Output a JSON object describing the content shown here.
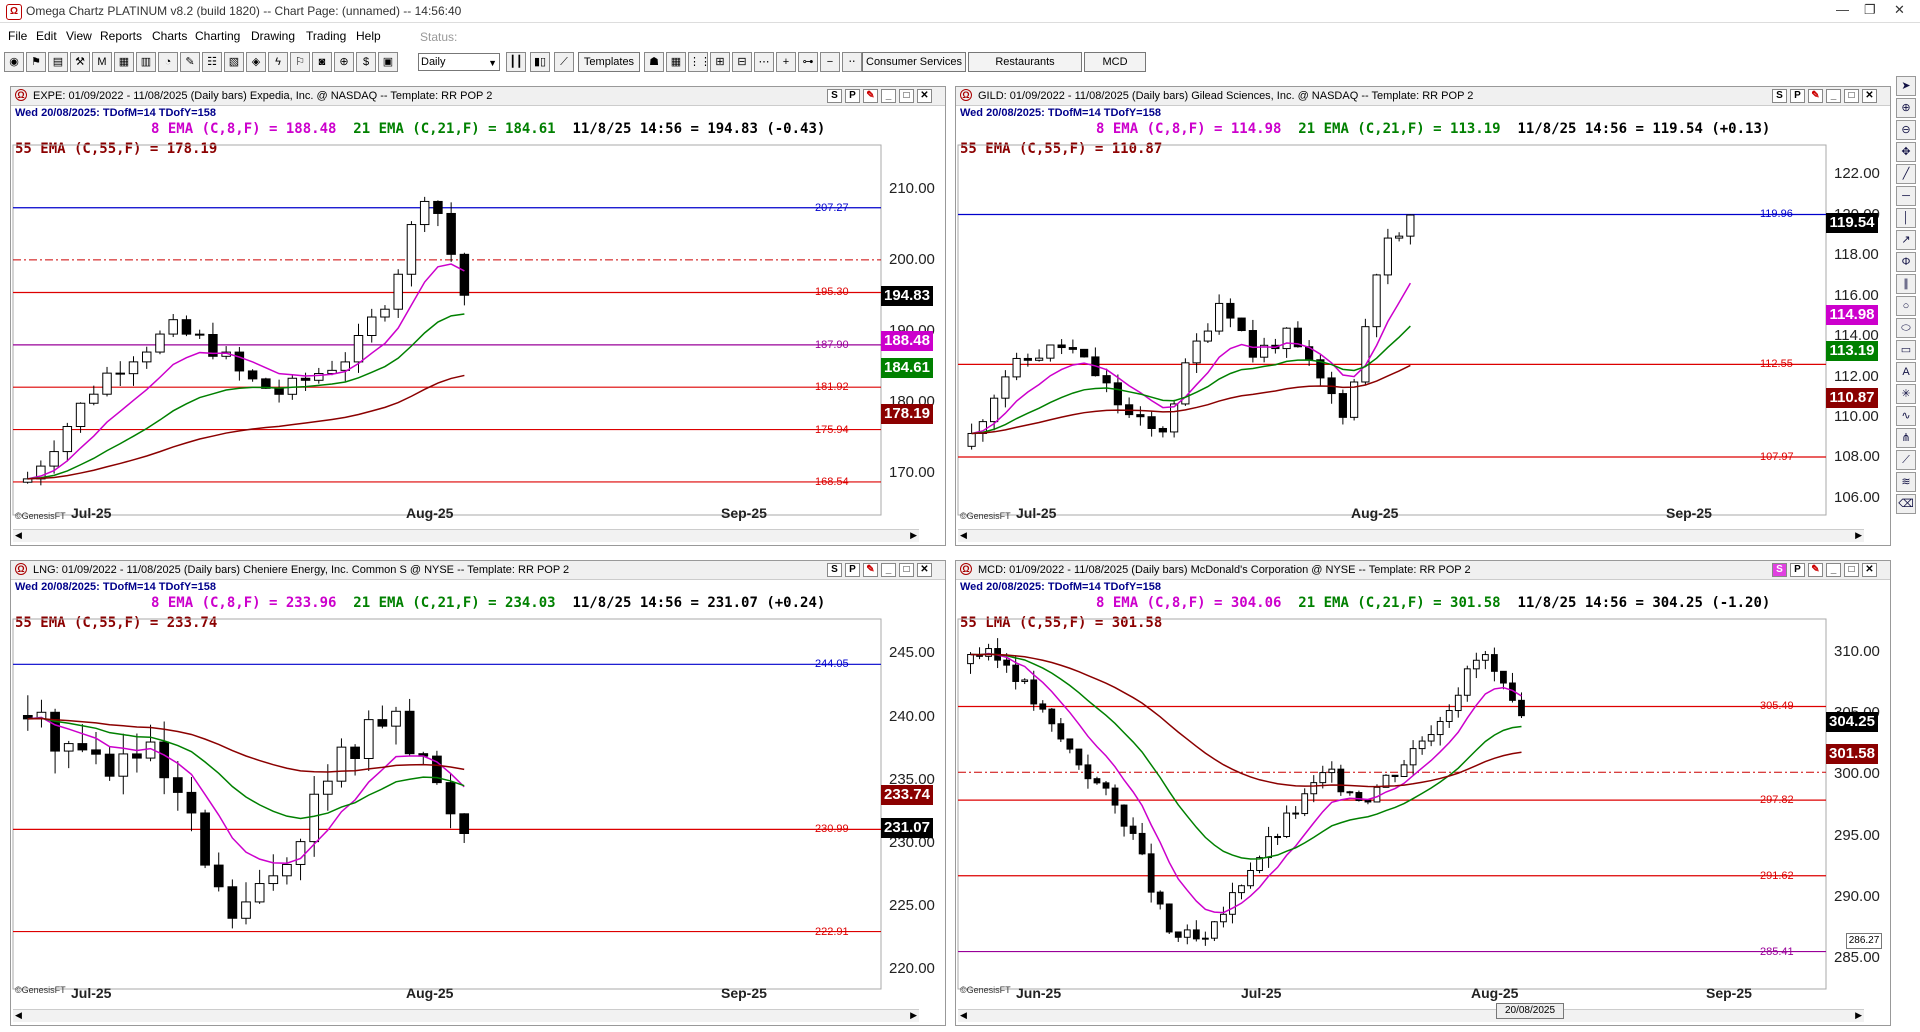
{
  "window": {
    "title": "Omega Chartz PLATINUM v8.2 (build 1820)  --  Chart Page: (unnamed) -- 14:56:40",
    "icon": "app-logo-icon",
    "controls": [
      "minimize-icon",
      "restore-icon",
      "close-icon"
    ]
  },
  "menu": {
    "items": [
      "File",
      "Edit",
      "View",
      "Reports",
      "Charts",
      "Charting",
      "Drawing",
      "Trading",
      "Help"
    ],
    "status_label": "Status:"
  },
  "toolbar": {
    "period_select": "Daily",
    "templates_label": "Templates",
    "tabs": [
      "Consumer Services",
      "Restaurants",
      "MCD"
    ]
  },
  "panels": [
    {
      "header": "EXPE: 01/09/2022 - 11/08/2025  (Daily bars)  Expedia, Inc. @ NASDAQ  --  Template: RR POP 2",
      "date_line": "Wed  20/08/2025:  TDofM=14  TDofY=158",
      "ema8": "8 EMA (C,8,F) = 188.48",
      "ema21": "21 EMA (C,21,F) = 184.61",
      "quote": "11/8/25 14:56 = 194.83 (-0.43)",
      "ema55": "55 EMA (C,55,F) = 178.19",
      "buttons": [
        "S",
        "P"
      ],
      "source": "©GenesisFT",
      "xlabels": [
        "Jul-25",
        "Aug-25",
        "Sep-25"
      ],
      "yticks": [
        "210.00",
        "200.00",
        "190.00",
        "180.00",
        "170.00"
      ],
      "hlines": [
        {
          "label": "207.27",
          "color": "#0000cc",
          "style": "solid"
        },
        {
          "label": "195.30",
          "color": "#dd0000",
          "style": "solid"
        },
        {
          "label": "187.90",
          "color": "#990099",
          "style": "solid"
        },
        {
          "label": "181.92",
          "color": "#dd0000",
          "style": "solid"
        },
        {
          "label": "175.94",
          "color": "#dd0000",
          "style": "solid"
        },
        {
          "label": "168.54",
          "color": "#dd0000",
          "style": "solid"
        }
      ],
      "value_tags": [
        {
          "text": "194.83",
          "bg": "#000000"
        },
        {
          "text": "188.48",
          "bg": "#cc00cc"
        },
        {
          "text": "184.61",
          "bg": "#008000"
        },
        {
          "text": "178.19",
          "bg": "#8b0000"
        }
      ]
    },
    {
      "header": "GILD: 01/09/2022 - 11/08/2025  (Daily bars)  Gilead Sciences, Inc. @ NASDAQ  --  Template: RR POP 2",
      "date_line": "Wed  20/08/2025:  TDofM=14  TDofY=158",
      "ema8": "8 EMA (C,8,F) = 114.98",
      "ema21": "21 EMA (C,21,F) = 113.19",
      "quote": "11/8/25 14:56 = 119.54 (+0.13)",
      "ema55": "55 EMA (C,55,F) = 110.87",
      "buttons": [
        "S",
        "P"
      ],
      "source": "©GenesisFT",
      "xlabels": [
        "Jul-25",
        "Aug-25",
        "Sep-25"
      ],
      "yticks": [
        "122.00",
        "120.00",
        "118.00",
        "116.00",
        "114.00",
        "112.00",
        "110.00",
        "108.00",
        "106.00"
      ],
      "hlines": [
        {
          "label": "119.96",
          "color": "#0000cc",
          "style": "solid"
        },
        {
          "label": "112.55",
          "color": "#dd0000",
          "style": "solid"
        },
        {
          "label": "107.97",
          "color": "#dd0000",
          "style": "solid"
        }
      ],
      "value_tags": [
        {
          "text": "119.54",
          "bg": "#000000"
        },
        {
          "text": "114.98",
          "bg": "#cc00cc"
        },
        {
          "text": "113.19",
          "bg": "#008000"
        },
        {
          "text": "110.87",
          "bg": "#8b0000"
        }
      ]
    },
    {
      "header": "LNG: 01/09/2022 - 11/08/2025  (Daily bars)  Cheniere Energy, Inc. Common S @ NYSE  --  Template: RR POP 2",
      "date_line": "Wed  20/08/2025:  TDofM=14  TDofY=158",
      "ema8": "8 EMA (C,8,F) = 233.96",
      "ema21": "21 EMA (C,21,F) = 234.03",
      "quote": "11/8/25 14:56 = 231.07 (+0.24)",
      "ema55": "55 EMA (C,55,F) = 233.74",
      "buttons": [
        "S",
        "P"
      ],
      "source": "©GenesisFT",
      "xlabels": [
        "Jul-25",
        "Aug-25",
        "Sep-25"
      ],
      "yticks": [
        "245.00",
        "240.00",
        "235.00",
        "230.00",
        "225.00",
        "220.00"
      ],
      "hlines": [
        {
          "label": "244.05",
          "color": "#0000cc",
          "style": "solid"
        },
        {
          "label": "230.99",
          "color": "#dd0000",
          "style": "solid"
        },
        {
          "label": "222.91",
          "color": "#dd0000",
          "style": "solid"
        }
      ],
      "value_tags": [
        {
          "text": "233.74",
          "bg": "#8b0000"
        },
        {
          "text": "231.07",
          "bg": "#000000"
        }
      ]
    },
    {
      "header": "MCD: 01/09/2022 - 11/08/2025  (Daily bars)  McDonald's Corporation @ NYSE  --  Template: RR POP 2",
      "date_line": "Wed  20/08/2025:  TDofM=14  TDofY=158",
      "ema8": "8 EMA (C,8,F) = 304.06",
      "ema21": "21 EMA (C,21,F) = 301.58",
      "quote": "11/8/25 14:56 = 304.25 (-1.20)",
      "ema55": "55 LMA (C,55,F) = 301.58",
      "buttons": [
        "S",
        "P"
      ],
      "source": "©GenesisFT",
      "xlabels": [
        "Jun-25",
        "Jul-25",
        "Aug-25",
        "Sep-25"
      ],
      "yticks": [
        "310.00",
        "305.00",
        "300.00",
        "295.00",
        "290.00",
        "285.00"
      ],
      "hlines": [
        {
          "label": "305.49",
          "color": "#dd0000",
          "style": "solid"
        },
        {
          "label": "297.82",
          "color": "#dd0000",
          "style": "solid"
        },
        {
          "label": "291.62",
          "color": "#dd0000",
          "style": "solid"
        },
        {
          "label": "285.41",
          "color": "#990099",
          "style": "solid"
        }
      ],
      "value_tags": [
        {
          "text": "304.25",
          "bg": "#000000"
        },
        {
          "text": "301.58",
          "bg": "#8b0000"
        }
      ],
      "date_tag": "20/08/2025",
      "num_tag": "286.27"
    }
  ],
  "side_tools": [
    "cursor-icon",
    "zoom-in-icon",
    "zoom-out-icon",
    "pan-icon",
    "trendline-icon",
    "hline-icon",
    "vline-icon",
    "arrow-icon",
    "fibonacci-icon",
    "channel-icon",
    "circle-icon",
    "ellipse-icon",
    "rectangle-icon",
    "text-icon",
    "gann-icon",
    "cycle-icon",
    "pitchfork-icon",
    "speed-line-icon",
    "regression-icon",
    "erase-icon"
  ]
}
